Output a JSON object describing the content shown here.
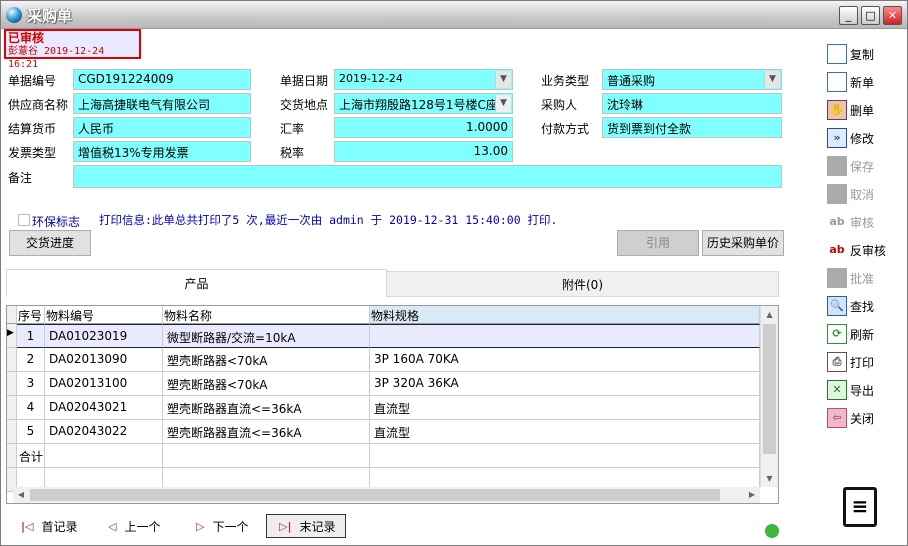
{
  "window": {
    "title": "采购单"
  },
  "status": {
    "state": "已审核",
    "auditor_line": "彭薏谷 2019-12-24 16:21"
  },
  "form": {
    "doc_no": {
      "label": "单据编号",
      "value": "CGD191224009"
    },
    "doc_date": {
      "label": "单据日期",
      "value": "2019-12-24"
    },
    "biz_type": {
      "label": "业务类型",
      "value": "普通采购"
    },
    "supplier": {
      "label": "供应商名称",
      "value": "上海高捷联电气有限公司"
    },
    "delivery_place": {
      "label": "交货地点",
      "value": "上海市翔殷路128号1号楼C座"
    },
    "buyer": {
      "label": "采购人",
      "value": "沈玲琳"
    },
    "currency": {
      "label": "结算货币",
      "value": "人民币"
    },
    "rate": {
      "label": "汇率",
      "value": "1.0000"
    },
    "payment": {
      "label": "付款方式",
      "value": "货到票到付全款"
    },
    "invoice_type": {
      "label": "发票类型",
      "value": "增值税13%专用发票"
    },
    "tax_rate": {
      "label": "税率",
      "value": "13.00"
    },
    "remark": {
      "label": "备注",
      "value": ""
    }
  },
  "eco_flag": {
    "label": "环保标志",
    "checked": false
  },
  "print_info": "打印信息:此单总共打印了5 次,最近一次由 admin 于 2019-12-31 15:40:00  打印.",
  "buttons": {
    "delivery_progress": "交货进度",
    "quote": "引用",
    "history_price": "历史采购单价"
  },
  "tabs": [
    {
      "label": "产品",
      "active": true
    },
    {
      "label": "附件(0)",
      "active": false
    }
  ],
  "grid": {
    "columns": [
      "序号",
      "物料编号",
      "物料名称",
      "物料规格"
    ],
    "rows": [
      [
        "1",
        "DA01023019",
        "微型断路器/交流=10kA",
        ""
      ],
      [
        "2",
        "DA02013090",
        "塑壳断路器<70kA",
        "3P 160A  70KA"
      ],
      [
        "3",
        "DA02013100",
        "塑壳断路器<70kA",
        "3P 320A  36KA"
      ],
      [
        "4",
        "DA02043021",
        "塑壳断路器直流<=36kA",
        "直流型"
      ],
      [
        "5",
        "DA02043022",
        "塑壳断路器直流<=36kA",
        "直流型"
      ]
    ],
    "total_label": "合计"
  },
  "toolbar": [
    {
      "label": "复制",
      "icon": "document-icon",
      "enabled": true
    },
    {
      "label": "新单",
      "icon": "document-icon",
      "enabled": true
    },
    {
      "label": "删单",
      "icon": "delete-hand-icon",
      "enabled": true
    },
    {
      "label": "修改",
      "icon": "edit-arrow-icon",
      "enabled": true
    },
    {
      "label": "保存",
      "icon": "save-icon",
      "enabled": false
    },
    {
      "label": "取消",
      "icon": "cancel-icon",
      "enabled": false
    },
    {
      "label": "审核",
      "icon": "audit-icon",
      "enabled": false
    },
    {
      "label": "反审核",
      "icon": "unaudit-icon",
      "enabled": true
    },
    {
      "label": "批准",
      "icon": "approve-icon",
      "enabled": false
    },
    {
      "label": "查找",
      "icon": "search-icon",
      "enabled": true
    },
    {
      "label": "刷新",
      "icon": "refresh-icon",
      "enabled": true
    },
    {
      "label": "打印",
      "icon": "printer-icon",
      "enabled": true
    },
    {
      "label": "导出",
      "icon": "excel-icon",
      "enabled": true
    },
    {
      "label": "关闭",
      "icon": "exit-door-icon",
      "enabled": true
    }
  ],
  "nav": {
    "first": "首记录",
    "prev": "上一个",
    "next": "下一个",
    "last": "末记录"
  }
}
